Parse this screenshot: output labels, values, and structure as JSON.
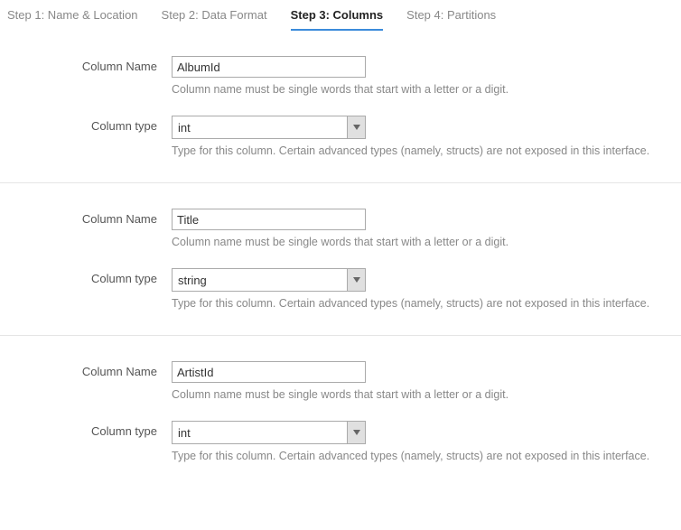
{
  "tabs": [
    {
      "label": "Step 1: Name & Location",
      "active": false
    },
    {
      "label": "Step 2: Data Format",
      "active": false
    },
    {
      "label": "Step 3: Columns",
      "active": true
    },
    {
      "label": "Step 4: Partitions",
      "active": false
    }
  ],
  "fieldLabels": {
    "columnName": "Column Name",
    "columnType": "Column type"
  },
  "hints": {
    "name": "Column name must be single words that start with a letter or a digit.",
    "type": "Type for this column. Certain advanced types (namely, structs) are not exposed in this interface."
  },
  "columns": [
    {
      "name": "AlbumId",
      "type": "int"
    },
    {
      "name": "Title",
      "type": "string"
    },
    {
      "name": "ArtistId",
      "type": "int"
    }
  ]
}
